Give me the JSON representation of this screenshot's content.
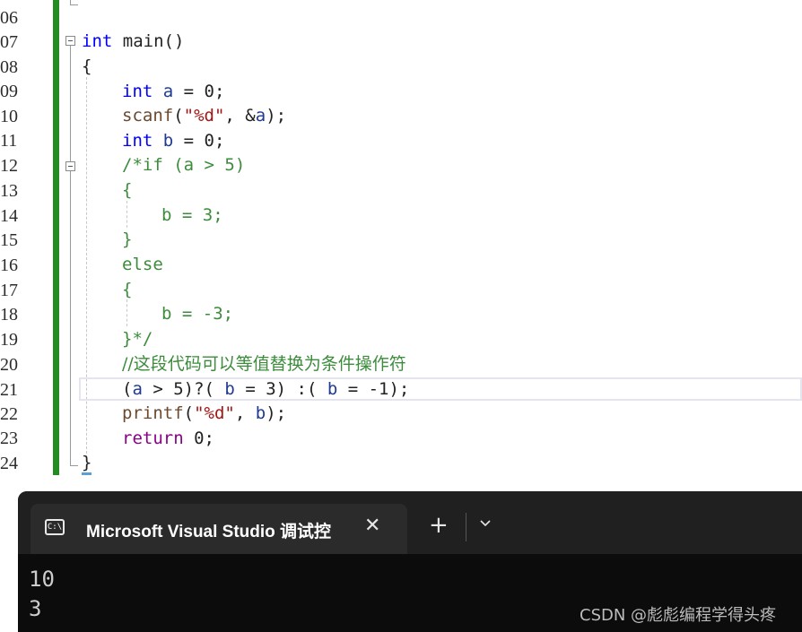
{
  "editor": {
    "line_numbers": [
      "06",
      "07",
      "08",
      "09",
      "10",
      "11",
      "12",
      "13",
      "14",
      "15",
      "16",
      "17",
      "18",
      "19",
      "20",
      "21",
      "22",
      "23",
      "24"
    ],
    "lines": {
      "l07": {
        "kw": "int",
        "rest": " main()"
      },
      "l08": "{",
      "l09": {
        "kw": "int",
        "var": "a",
        "rest": " = 0;"
      },
      "l10": {
        "fn": "scanf",
        "p1": "(",
        "str": "\"%d\"",
        "p2": ", &",
        "var": "a",
        "p3": ");"
      },
      "l11": {
        "kw": "int",
        "var": "b",
        "rest": " = 0;"
      },
      "l12": "/*if (a > 5)",
      "l13": "{",
      "l14": "b = 3;",
      "l15": "}",
      "l16": "else",
      "l17": "{",
      "l18": "b = -3;",
      "l19": "}*/",
      "l20": "//这段代码可以等值替换为条件操作符",
      "l21": {
        "p1": "(",
        "v1": "a",
        "p2": " > 5)?( ",
        "v2": "b",
        "p3": " = 3) :( ",
        "v3": "b",
        "p4": " = -1);"
      },
      "l22": {
        "fn": "printf",
        "p1": "(",
        "str": "\"%d\"",
        "p2": ", ",
        "var": "b",
        "p3": ");"
      },
      "l23": {
        "kw": "return",
        "rest": " 0;"
      },
      "l24": "}"
    }
  },
  "terminal": {
    "icon": "console-icon",
    "icon_text": "C:\\",
    "tab_title": "Microsoft Visual Studio 调试控",
    "close_glyph": "✕",
    "new_tab_glyph": "+",
    "output": [
      "10",
      "3"
    ]
  },
  "watermark": "CSDN @彪彪编程学得头疼",
  "colors": {
    "keyword": "#0000ff",
    "comment": "#3c8c3c",
    "string": "#a31515",
    "gutter_bar": "#228b22",
    "terminal_bg": "#0c0c0c"
  }
}
